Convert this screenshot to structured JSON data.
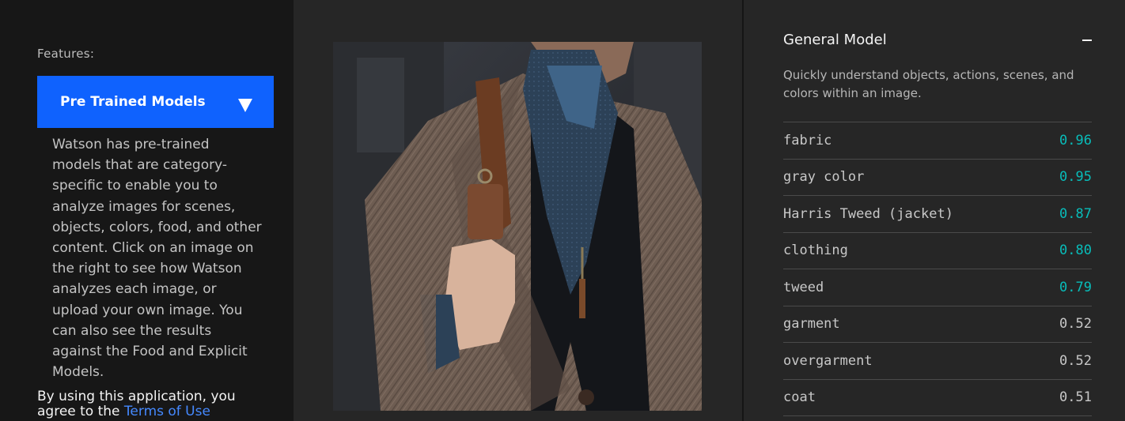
{
  "sidebar": {
    "features_label": "Features:",
    "dropdown": {
      "selected": "Pre Trained Models"
    },
    "description": "Watson has pre-trained models that are category-specific to enable you to analyze images for scenes, objects, colors, food, and other content. Click on an image on the right to see how Watson analyzes each image, or upload your own image. You can also see the results against the Food and Explicit Models.",
    "terms_prefix": "By using this application, you agree to the",
    "terms_link": "Terms of Use"
  },
  "colors": {
    "accent": "#0f62fe",
    "link": "#4589ff",
    "high_score": "#08bdba"
  },
  "results_panel": {
    "title": "General Model",
    "description": "Quickly understand objects, actions, scenes, and colors within an image.",
    "classes": [
      {
        "label": "fabric",
        "score": "0.96",
        "high": true
      },
      {
        "label": "gray color",
        "score": "0.95",
        "high": true
      },
      {
        "label": "Harris Tweed (jacket)",
        "score": "0.87",
        "high": true
      },
      {
        "label": "clothing",
        "score": "0.80",
        "high": true
      },
      {
        "label": "tweed",
        "score": "0.79",
        "high": true
      },
      {
        "label": "garment",
        "score": "0.52",
        "high": false
      },
      {
        "label": "overgarment",
        "score": "0.52",
        "high": false
      },
      {
        "label": "coat",
        "score": "0.51",
        "high": false
      }
    ]
  }
}
